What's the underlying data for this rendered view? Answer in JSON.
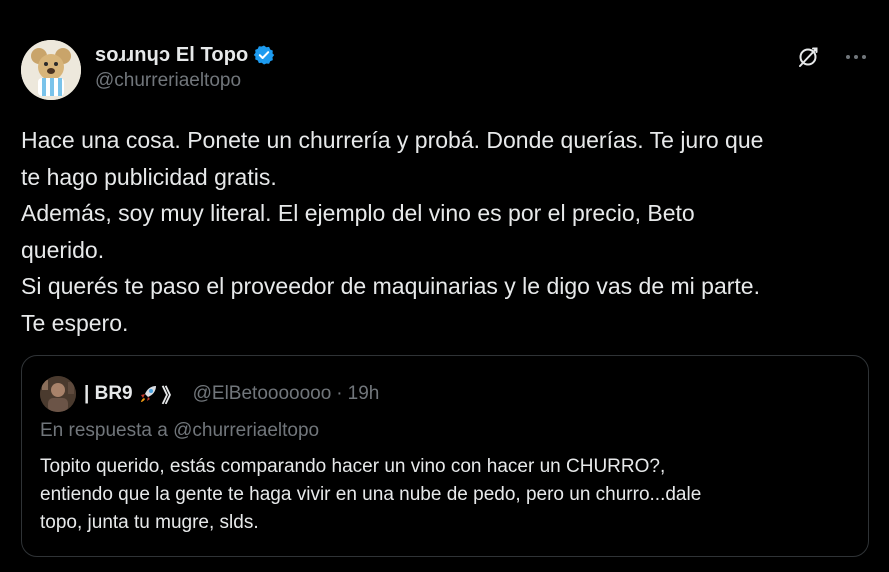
{
  "author": {
    "display_name": "soɹɹnɥɔ El Topo",
    "handle": "@churreriaeltopo",
    "verified": true
  },
  "icons": {
    "verified": "verified-badge-icon",
    "grok": "grok-icon",
    "more": "more-options-icon",
    "rocket": "rocket-emoji-icon"
  },
  "colors": {
    "background": "#000000",
    "text": "#e7e9ea",
    "muted": "#71767b",
    "verified_blue": "#1d9bf0",
    "border": "#2f3336"
  },
  "tweet": {
    "text": "Hace una cosa. Ponete un churrería y probá. Donde querías. Te juro que\nte hago publicidad gratis.\nAdemás, soy muy literal. El ejemplo del vino es por el precio, Beto\nquerido.\nSi querés te paso el proveedor de maquinarias y le digo vas de mi parte.\nTe espero."
  },
  "quote": {
    "display_name": "| BR9",
    "name_suffix": "》",
    "handle": "@ElBetooooooo",
    "separator": "·",
    "time": "19h",
    "reply_prefix": "En respuesta a",
    "reply_handle": "@churreriaeltopo",
    "text": "Topito querido, estás comparando hacer un vino con hacer un CHURRO?,\nentiendo que la gente te haga vivir en una nube de pedo, pero un churro...dale\ntopo, junta tu mugre, slds."
  }
}
